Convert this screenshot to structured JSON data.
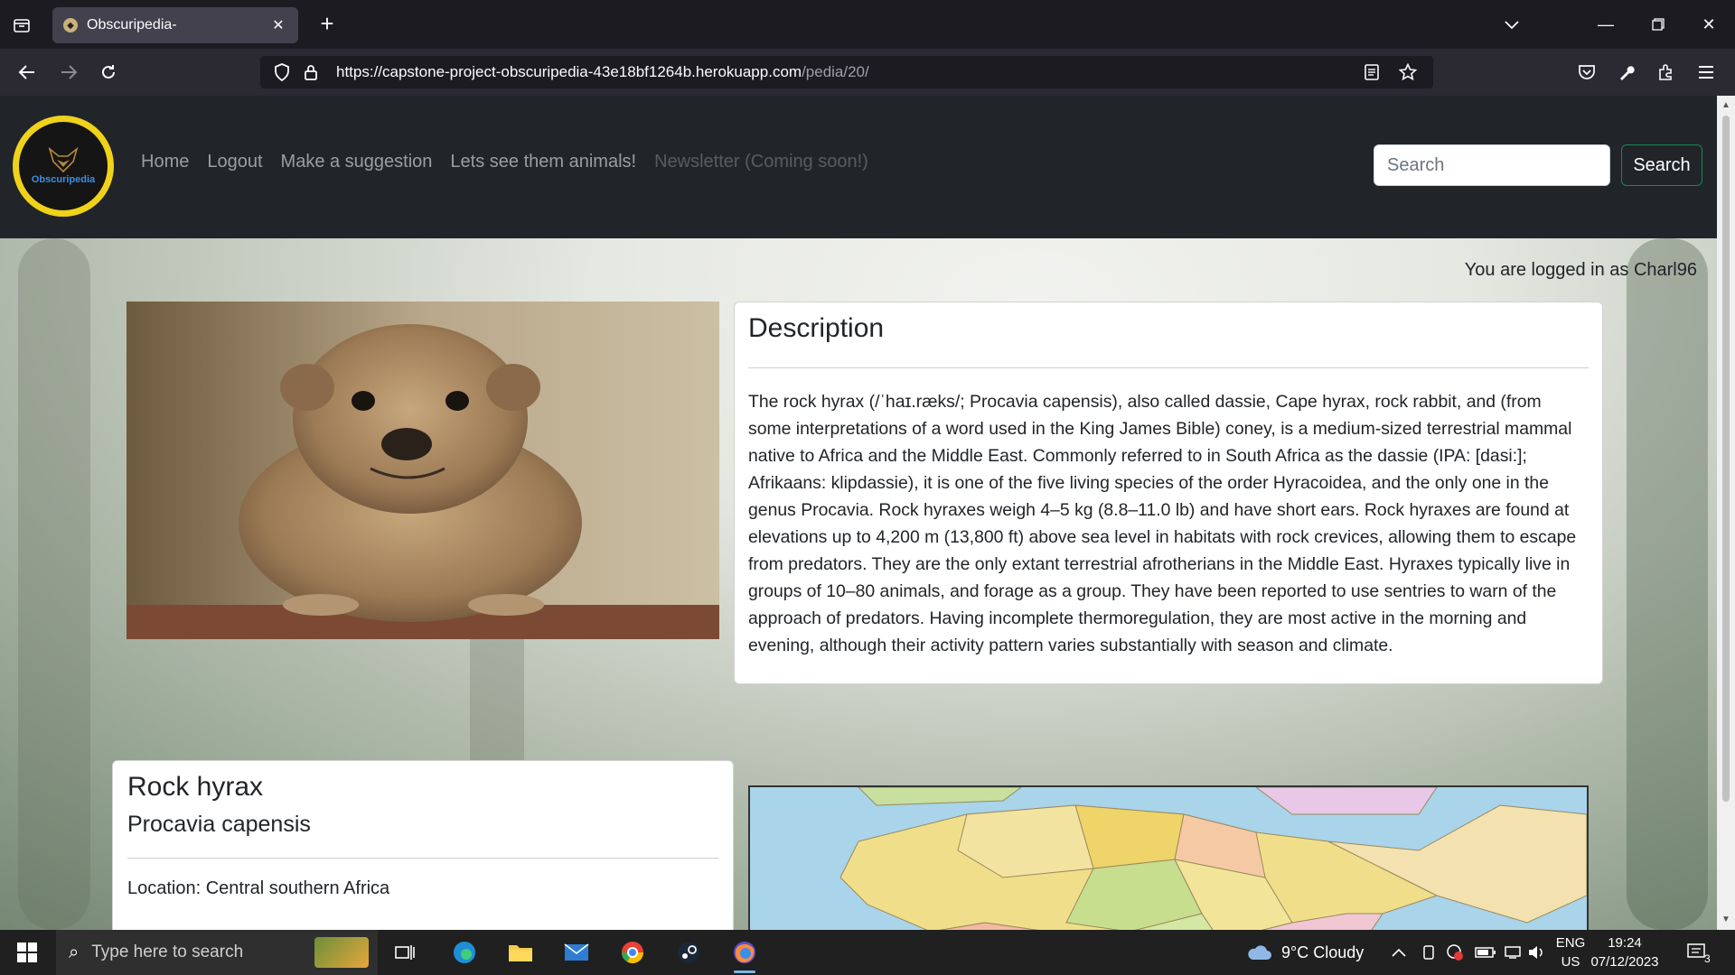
{
  "browser": {
    "tab_title": "Obscuripedia-",
    "url_host": "https://capstone-project-obscuripedia-43e18bf1264b.herokuapp.com",
    "url_path": "/pedia/20/"
  },
  "site": {
    "logo_text": "Obscuripedia",
    "nav": {
      "home": "Home",
      "logout": "Logout",
      "suggest": "Make a suggestion",
      "animals": "Lets see them animals!",
      "newsletter": "Newsletter (Coming soon!)"
    },
    "search_placeholder": "Search",
    "search_button": "Search",
    "logged_in": "You are logged in as Charl96"
  },
  "animal": {
    "common_name": "Rock hyrax",
    "scientific_name": "Procavia capensis",
    "location": "Location: Central southern Africa",
    "description_heading": "Description",
    "description": "The rock hyrax (/ˈhaɪ.ræks/; Procavia capensis), also called dassie, Cape hyrax, rock rabbit, and (from some interpretations of a word used in the King James Bible) coney, is a medium-sized terrestrial mammal native to Africa and the Middle East. Commonly referred to in South Africa as the dassie (IPA: [dasi:]; Afrikaans: klipdassie), it is one of the five living species of the order Hyracoidea, and the only one in the genus Procavia. Rock hyraxes weigh 4–5 kg (8.8–11.0 lb) and have short ears. Rock hyraxes are found at elevations up to 4,200 m (13,800 ft) above sea level in habitats with rock crevices, allowing them to escape from predators. They are the only extant terrestrial afrotherians in the Middle East. Hyraxes typically live in groups of 10–80 animals, and forage as a group. They have been reported to use sentries to warn of the approach of predators. Having incomplete thermoregulation, they are most active in the morning and evening, although their activity pattern varies substantially with season and climate."
  },
  "taskbar": {
    "search_placeholder": "Type here to search",
    "weather": "9°C  Cloudy",
    "lang_1": "ENG",
    "lang_2": "US",
    "time": "19:24",
    "date": "07/12/2023",
    "notifications": "3"
  },
  "colors": {
    "accent_logo": "#f0d21a",
    "search_border": "#198754",
    "site_nav_bg": "#212529"
  }
}
